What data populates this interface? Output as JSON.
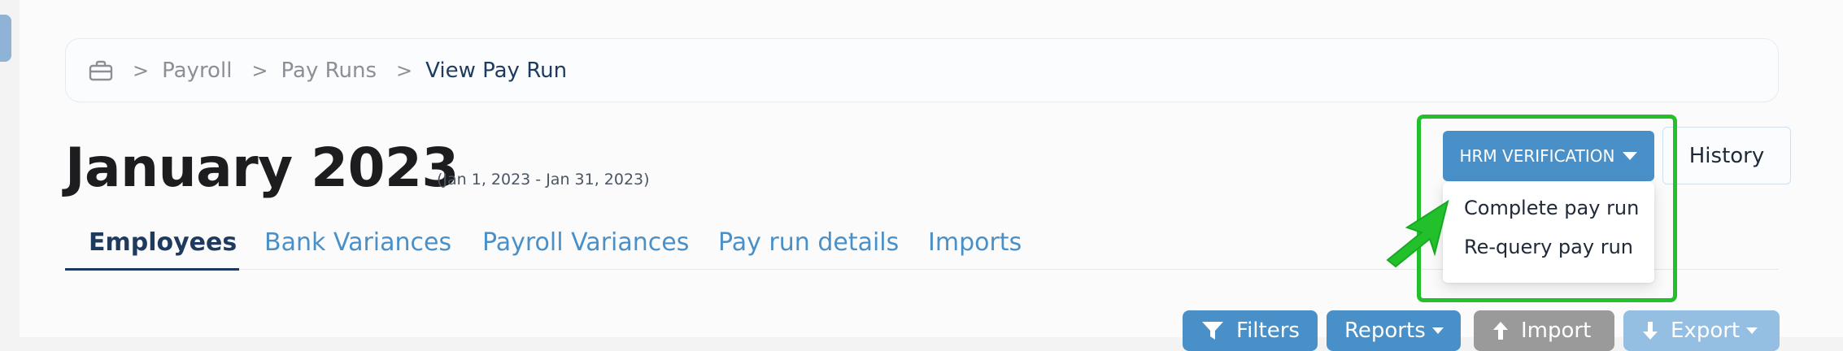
{
  "breadcrumb": {
    "items": [
      "Payroll",
      "Pay Runs"
    ],
    "current": "View Pay Run"
  },
  "header": {
    "title": "January 2023",
    "date_range": "(Jan 1, 2023 - Jan 31, 2023)"
  },
  "tabs": [
    {
      "label": "Employees",
      "active": true
    },
    {
      "label": "Bank Variances"
    },
    {
      "label": "Payroll Variances"
    },
    {
      "label": "Pay run details"
    },
    {
      "label": "Imports"
    }
  ],
  "actions": {
    "hrm_verification_label": "HRM VERIFICATION",
    "history_label": "History",
    "dropdown_items": [
      "Complete pay run",
      "Re-query pay run"
    ]
  },
  "toolbar": {
    "filters_label": "Filters",
    "reports_label": "Reports",
    "import_label": "Import",
    "export_label": "Export"
  },
  "colors": {
    "accent": "#4a90c8",
    "dark_navy": "#1e3a5f",
    "highlight": "#22c12c",
    "disabled_gray": "#9a9a9a",
    "disabled_blue": "#94bfe3"
  },
  "icons": [
    "briefcase-icon",
    "chevron-right-icon",
    "caret-down-icon",
    "filter-icon",
    "upload-icon",
    "download-icon",
    "pointer-arrow-icon"
  ]
}
